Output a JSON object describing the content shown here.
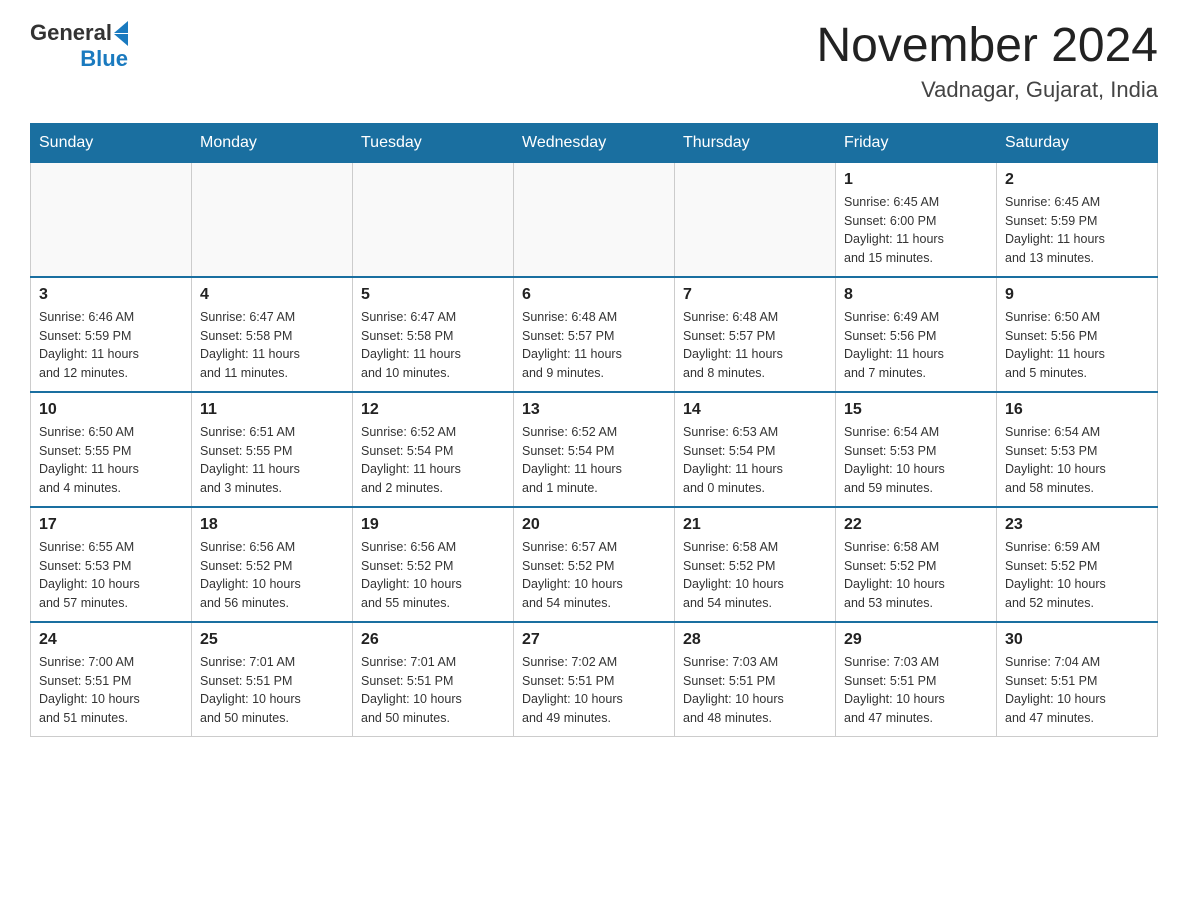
{
  "header": {
    "logo": {
      "general": "General",
      "blue": "Blue"
    },
    "title": "November 2024",
    "location": "Vadnagar, Gujarat, India"
  },
  "weekdays": [
    "Sunday",
    "Monday",
    "Tuesday",
    "Wednesday",
    "Thursday",
    "Friday",
    "Saturday"
  ],
  "weeks": [
    [
      {
        "day": "",
        "info": ""
      },
      {
        "day": "",
        "info": ""
      },
      {
        "day": "",
        "info": ""
      },
      {
        "day": "",
        "info": ""
      },
      {
        "day": "",
        "info": ""
      },
      {
        "day": "1",
        "info": "Sunrise: 6:45 AM\nSunset: 6:00 PM\nDaylight: 11 hours\nand 15 minutes."
      },
      {
        "day": "2",
        "info": "Sunrise: 6:45 AM\nSunset: 5:59 PM\nDaylight: 11 hours\nand 13 minutes."
      }
    ],
    [
      {
        "day": "3",
        "info": "Sunrise: 6:46 AM\nSunset: 5:59 PM\nDaylight: 11 hours\nand 12 minutes."
      },
      {
        "day": "4",
        "info": "Sunrise: 6:47 AM\nSunset: 5:58 PM\nDaylight: 11 hours\nand 11 minutes."
      },
      {
        "day": "5",
        "info": "Sunrise: 6:47 AM\nSunset: 5:58 PM\nDaylight: 11 hours\nand 10 minutes."
      },
      {
        "day": "6",
        "info": "Sunrise: 6:48 AM\nSunset: 5:57 PM\nDaylight: 11 hours\nand 9 minutes."
      },
      {
        "day": "7",
        "info": "Sunrise: 6:48 AM\nSunset: 5:57 PM\nDaylight: 11 hours\nand 8 minutes."
      },
      {
        "day": "8",
        "info": "Sunrise: 6:49 AM\nSunset: 5:56 PM\nDaylight: 11 hours\nand 7 minutes."
      },
      {
        "day": "9",
        "info": "Sunrise: 6:50 AM\nSunset: 5:56 PM\nDaylight: 11 hours\nand 5 minutes."
      }
    ],
    [
      {
        "day": "10",
        "info": "Sunrise: 6:50 AM\nSunset: 5:55 PM\nDaylight: 11 hours\nand 4 minutes."
      },
      {
        "day": "11",
        "info": "Sunrise: 6:51 AM\nSunset: 5:55 PM\nDaylight: 11 hours\nand 3 minutes."
      },
      {
        "day": "12",
        "info": "Sunrise: 6:52 AM\nSunset: 5:54 PM\nDaylight: 11 hours\nand 2 minutes."
      },
      {
        "day": "13",
        "info": "Sunrise: 6:52 AM\nSunset: 5:54 PM\nDaylight: 11 hours\nand 1 minute."
      },
      {
        "day": "14",
        "info": "Sunrise: 6:53 AM\nSunset: 5:54 PM\nDaylight: 11 hours\nand 0 minutes."
      },
      {
        "day": "15",
        "info": "Sunrise: 6:54 AM\nSunset: 5:53 PM\nDaylight: 10 hours\nand 59 minutes."
      },
      {
        "day": "16",
        "info": "Sunrise: 6:54 AM\nSunset: 5:53 PM\nDaylight: 10 hours\nand 58 minutes."
      }
    ],
    [
      {
        "day": "17",
        "info": "Sunrise: 6:55 AM\nSunset: 5:53 PM\nDaylight: 10 hours\nand 57 minutes."
      },
      {
        "day": "18",
        "info": "Sunrise: 6:56 AM\nSunset: 5:52 PM\nDaylight: 10 hours\nand 56 minutes."
      },
      {
        "day": "19",
        "info": "Sunrise: 6:56 AM\nSunset: 5:52 PM\nDaylight: 10 hours\nand 55 minutes."
      },
      {
        "day": "20",
        "info": "Sunrise: 6:57 AM\nSunset: 5:52 PM\nDaylight: 10 hours\nand 54 minutes."
      },
      {
        "day": "21",
        "info": "Sunrise: 6:58 AM\nSunset: 5:52 PM\nDaylight: 10 hours\nand 54 minutes."
      },
      {
        "day": "22",
        "info": "Sunrise: 6:58 AM\nSunset: 5:52 PM\nDaylight: 10 hours\nand 53 minutes."
      },
      {
        "day": "23",
        "info": "Sunrise: 6:59 AM\nSunset: 5:52 PM\nDaylight: 10 hours\nand 52 minutes."
      }
    ],
    [
      {
        "day": "24",
        "info": "Sunrise: 7:00 AM\nSunset: 5:51 PM\nDaylight: 10 hours\nand 51 minutes."
      },
      {
        "day": "25",
        "info": "Sunrise: 7:01 AM\nSunset: 5:51 PM\nDaylight: 10 hours\nand 50 minutes."
      },
      {
        "day": "26",
        "info": "Sunrise: 7:01 AM\nSunset: 5:51 PM\nDaylight: 10 hours\nand 50 minutes."
      },
      {
        "day": "27",
        "info": "Sunrise: 7:02 AM\nSunset: 5:51 PM\nDaylight: 10 hours\nand 49 minutes."
      },
      {
        "day": "28",
        "info": "Sunrise: 7:03 AM\nSunset: 5:51 PM\nDaylight: 10 hours\nand 48 minutes."
      },
      {
        "day": "29",
        "info": "Sunrise: 7:03 AM\nSunset: 5:51 PM\nDaylight: 10 hours\nand 47 minutes."
      },
      {
        "day": "30",
        "info": "Sunrise: 7:04 AM\nSunset: 5:51 PM\nDaylight: 10 hours\nand 47 minutes."
      }
    ]
  ]
}
